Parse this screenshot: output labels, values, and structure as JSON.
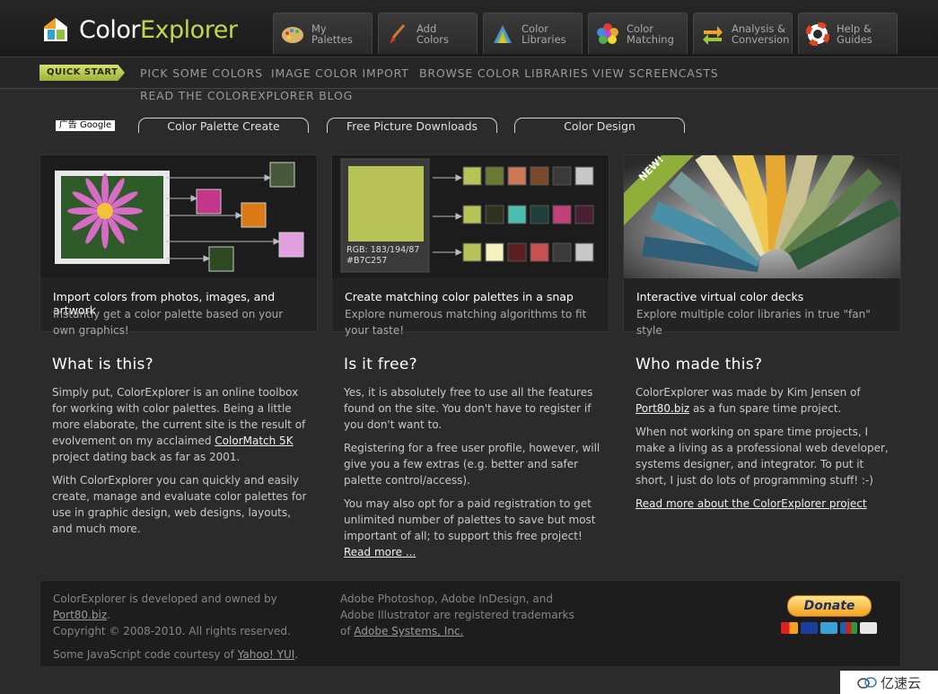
{
  "brand": {
    "part1": "Color",
    "part2": "Explorer"
  },
  "main_tabs": [
    {
      "line1": "My",
      "line2": "Palettes",
      "icon": "palette-icon"
    },
    {
      "line1": "Add",
      "line2": "Colors",
      "icon": "paintbrush-icon"
    },
    {
      "line1": "Color",
      "line2": "Libraries",
      "icon": "library-icon"
    },
    {
      "line1": "Color",
      "line2": "Matching",
      "icon": "flower-icon"
    },
    {
      "line1": "Analysis &",
      "line2": "Conversion",
      "icon": "arrows-icon"
    },
    {
      "line1": "Help &",
      "line2": "Guides",
      "icon": "lifebuoy-icon"
    }
  ],
  "subnav": {
    "quickstart": "QUICK START",
    "links": [
      "PICK SOME COLORS",
      "IMAGE COLOR IMPORT",
      "BROWSE COLOR LIBRARIES",
      "VIEW SCREENCASTS",
      "READ THE COLOREXPLORER BLOG"
    ]
  },
  "ads": {
    "label": "广告 Google",
    "links": [
      "Color Palette Create",
      "Free Picture Downloads",
      "Color Design"
    ]
  },
  "cards": [
    {
      "title": "Import colors from photos, images, and artwork",
      "desc": "Instantly get a color palette based on your own graphics!"
    },
    {
      "title": "Create matching color palettes in a snap",
      "desc": "Explore numerous matching algorithms to fit your taste!",
      "rgb": "RGB: 183/194/87",
      "hex": "#B7C257"
    },
    {
      "title": "Interactive virtual color decks",
      "desc": "Explore multiple color libraries in true \"fan\" style",
      "ribbon": "NEW!"
    }
  ],
  "columns": {
    "what": {
      "heading": "What is this?",
      "p1_a": "Simply put, ColorExplorer is an online toolbox for working with color palettes. Being a little more elaborate, the current site is the result of evolvement on my acclaimed ",
      "p1_link": "ColorMatch 5K",
      "p1_b": " project dating back as far as 2001.",
      "p2": "With ColorExplorer you can quickly and easily create, manage and evaluate color palettes for use in graphic design, web designs, layouts, and much more."
    },
    "free": {
      "heading": "Is it free?",
      "p1": "Yes, it is absolutely free to use all the features found on the site. You don't have to register if you don't want to.",
      "p2": "Registering for a free user profile, however, will give you a few extras (e.g. better and safer palette control/access).",
      "p3_a": "You may also opt for a paid registration to get unlimited number of palettes to save but most important of all; to support this free project! ",
      "p3_link": "Read more ..."
    },
    "who": {
      "heading": "Who made this?",
      "p1_a": "ColorExplorer was made by Kim Jensen of ",
      "p1_link": "Port80.biz",
      "p1_b": " as a fun spare time project.",
      "p2": "When not working on spare time projects, I make a living as a professional web developer, systems designer, and integrator. To put it short, I just do lots of programming stuff! :-)",
      "p3_link": "Read more about the ColorExplorer project"
    }
  },
  "footer": {
    "c1_a": "ColorExplorer is developed and owned by ",
    "c1_link": "Port80.biz",
    "c1_b": ".",
    "c1_line2": "Copyright © 2008-2010. All rights reserved.",
    "c1_line3_a": "Some JavaScript code courtesy of ",
    "c1_line3_link": "Yahoo! YUI",
    "c1_line3_b": ".",
    "c2_a": "Adobe Photoshop, Adobe InDesign, and Adobe Illustrator are registered trademarks of ",
    "c2_link": "Adobe Systems, Inc.",
    "donate": "Donate",
    "cards": [
      "mastercard-icon",
      "visa-icon",
      "amex-icon",
      "jcb-icon",
      "bank-icon"
    ]
  },
  "watermark": "亿速云",
  "colors": {
    "accent": "#c5d54e",
    "background": "#2b2b2b",
    "swatch_main": "#B7C257"
  }
}
